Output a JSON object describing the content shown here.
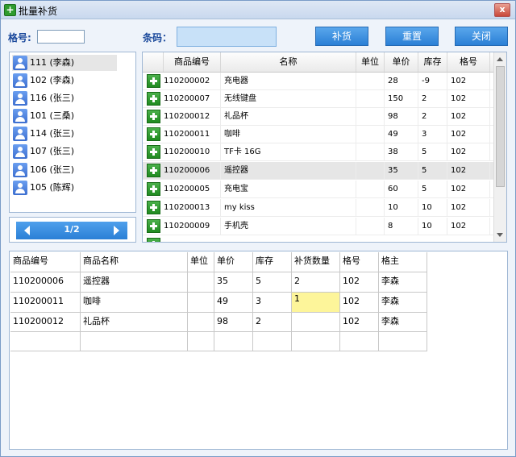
{
  "window": {
    "title": "批量补货",
    "close_symbol": "x"
  },
  "toolbar": {
    "grid_label": "格号:",
    "grid_value": "",
    "barcode_label": "条码：",
    "barcode_value": "",
    "restock_button": "补货",
    "reset_button": "重置",
    "close_button": "关闭"
  },
  "owner_list": [
    {
      "label": "111 (李森)",
      "selected": true
    },
    {
      "label": "102 (李森)"
    },
    {
      "label": "116 (张三)"
    },
    {
      "label": "101 (三桑)"
    },
    {
      "label": "114 (张三)"
    },
    {
      "label": "107 (张三)"
    },
    {
      "label": "106 (张三)"
    },
    {
      "label": "105 (陈辉)"
    }
  ],
  "pager": {
    "text": "1/2"
  },
  "product_grid": {
    "headers": [
      "商品编号",
      "名称",
      "单位",
      "单价",
      "库存",
      "格号"
    ],
    "rows": [
      {
        "code": "110200002",
        "name": "充电器",
        "unit": "",
        "price": "28",
        "stock": "-9",
        "grid": "102"
      },
      {
        "code": "110200007",
        "name": "无线键盘",
        "unit": "",
        "price": "150",
        "stock": "2",
        "grid": "102"
      },
      {
        "code": "110200012",
        "name": "礼品杯",
        "unit": "",
        "price": "98",
        "stock": "2",
        "grid": "102"
      },
      {
        "code": "110200011",
        "name": "咖啡",
        "unit": "",
        "price": "49",
        "stock": "3",
        "grid": "102"
      },
      {
        "code": "110200010",
        "name": "TF卡 16G",
        "unit": "",
        "price": "38",
        "stock": "5",
        "grid": "102"
      },
      {
        "code": "110200006",
        "name": "遥控器",
        "unit": "",
        "price": "35",
        "stock": "5",
        "grid": "102",
        "selected": true
      },
      {
        "code": "110200005",
        "name": "充电宝",
        "unit": "",
        "price": "60",
        "stock": "5",
        "grid": "102"
      },
      {
        "code": "110200013",
        "name": "my kiss",
        "unit": "",
        "price": "10",
        "stock": "10",
        "grid": "102"
      },
      {
        "code": "110200009",
        "name": "手机壳",
        "unit": "",
        "price": "8",
        "stock": "10",
        "grid": "102"
      }
    ]
  },
  "restock_table": {
    "headers": [
      "商品编号",
      "商品名称",
      "单位",
      "单价",
      "库存",
      "补货数量",
      "格号",
      "格主"
    ],
    "rows": [
      [
        "110200006",
        "遥控器",
        "",
        "35",
        "5",
        "2",
        "102",
        "李森"
      ],
      [
        "110200011",
        "咖啡",
        "",
        "49",
        "3",
        "1",
        "102",
        "李森"
      ],
      [
        "110200012",
        "礼品杯",
        "",
        "98",
        "2",
        "",
        "102",
        "李森"
      ],
      [
        "",
        "",
        "",
        "",
        "",
        "",
        "",
        ""
      ]
    ]
  }
}
